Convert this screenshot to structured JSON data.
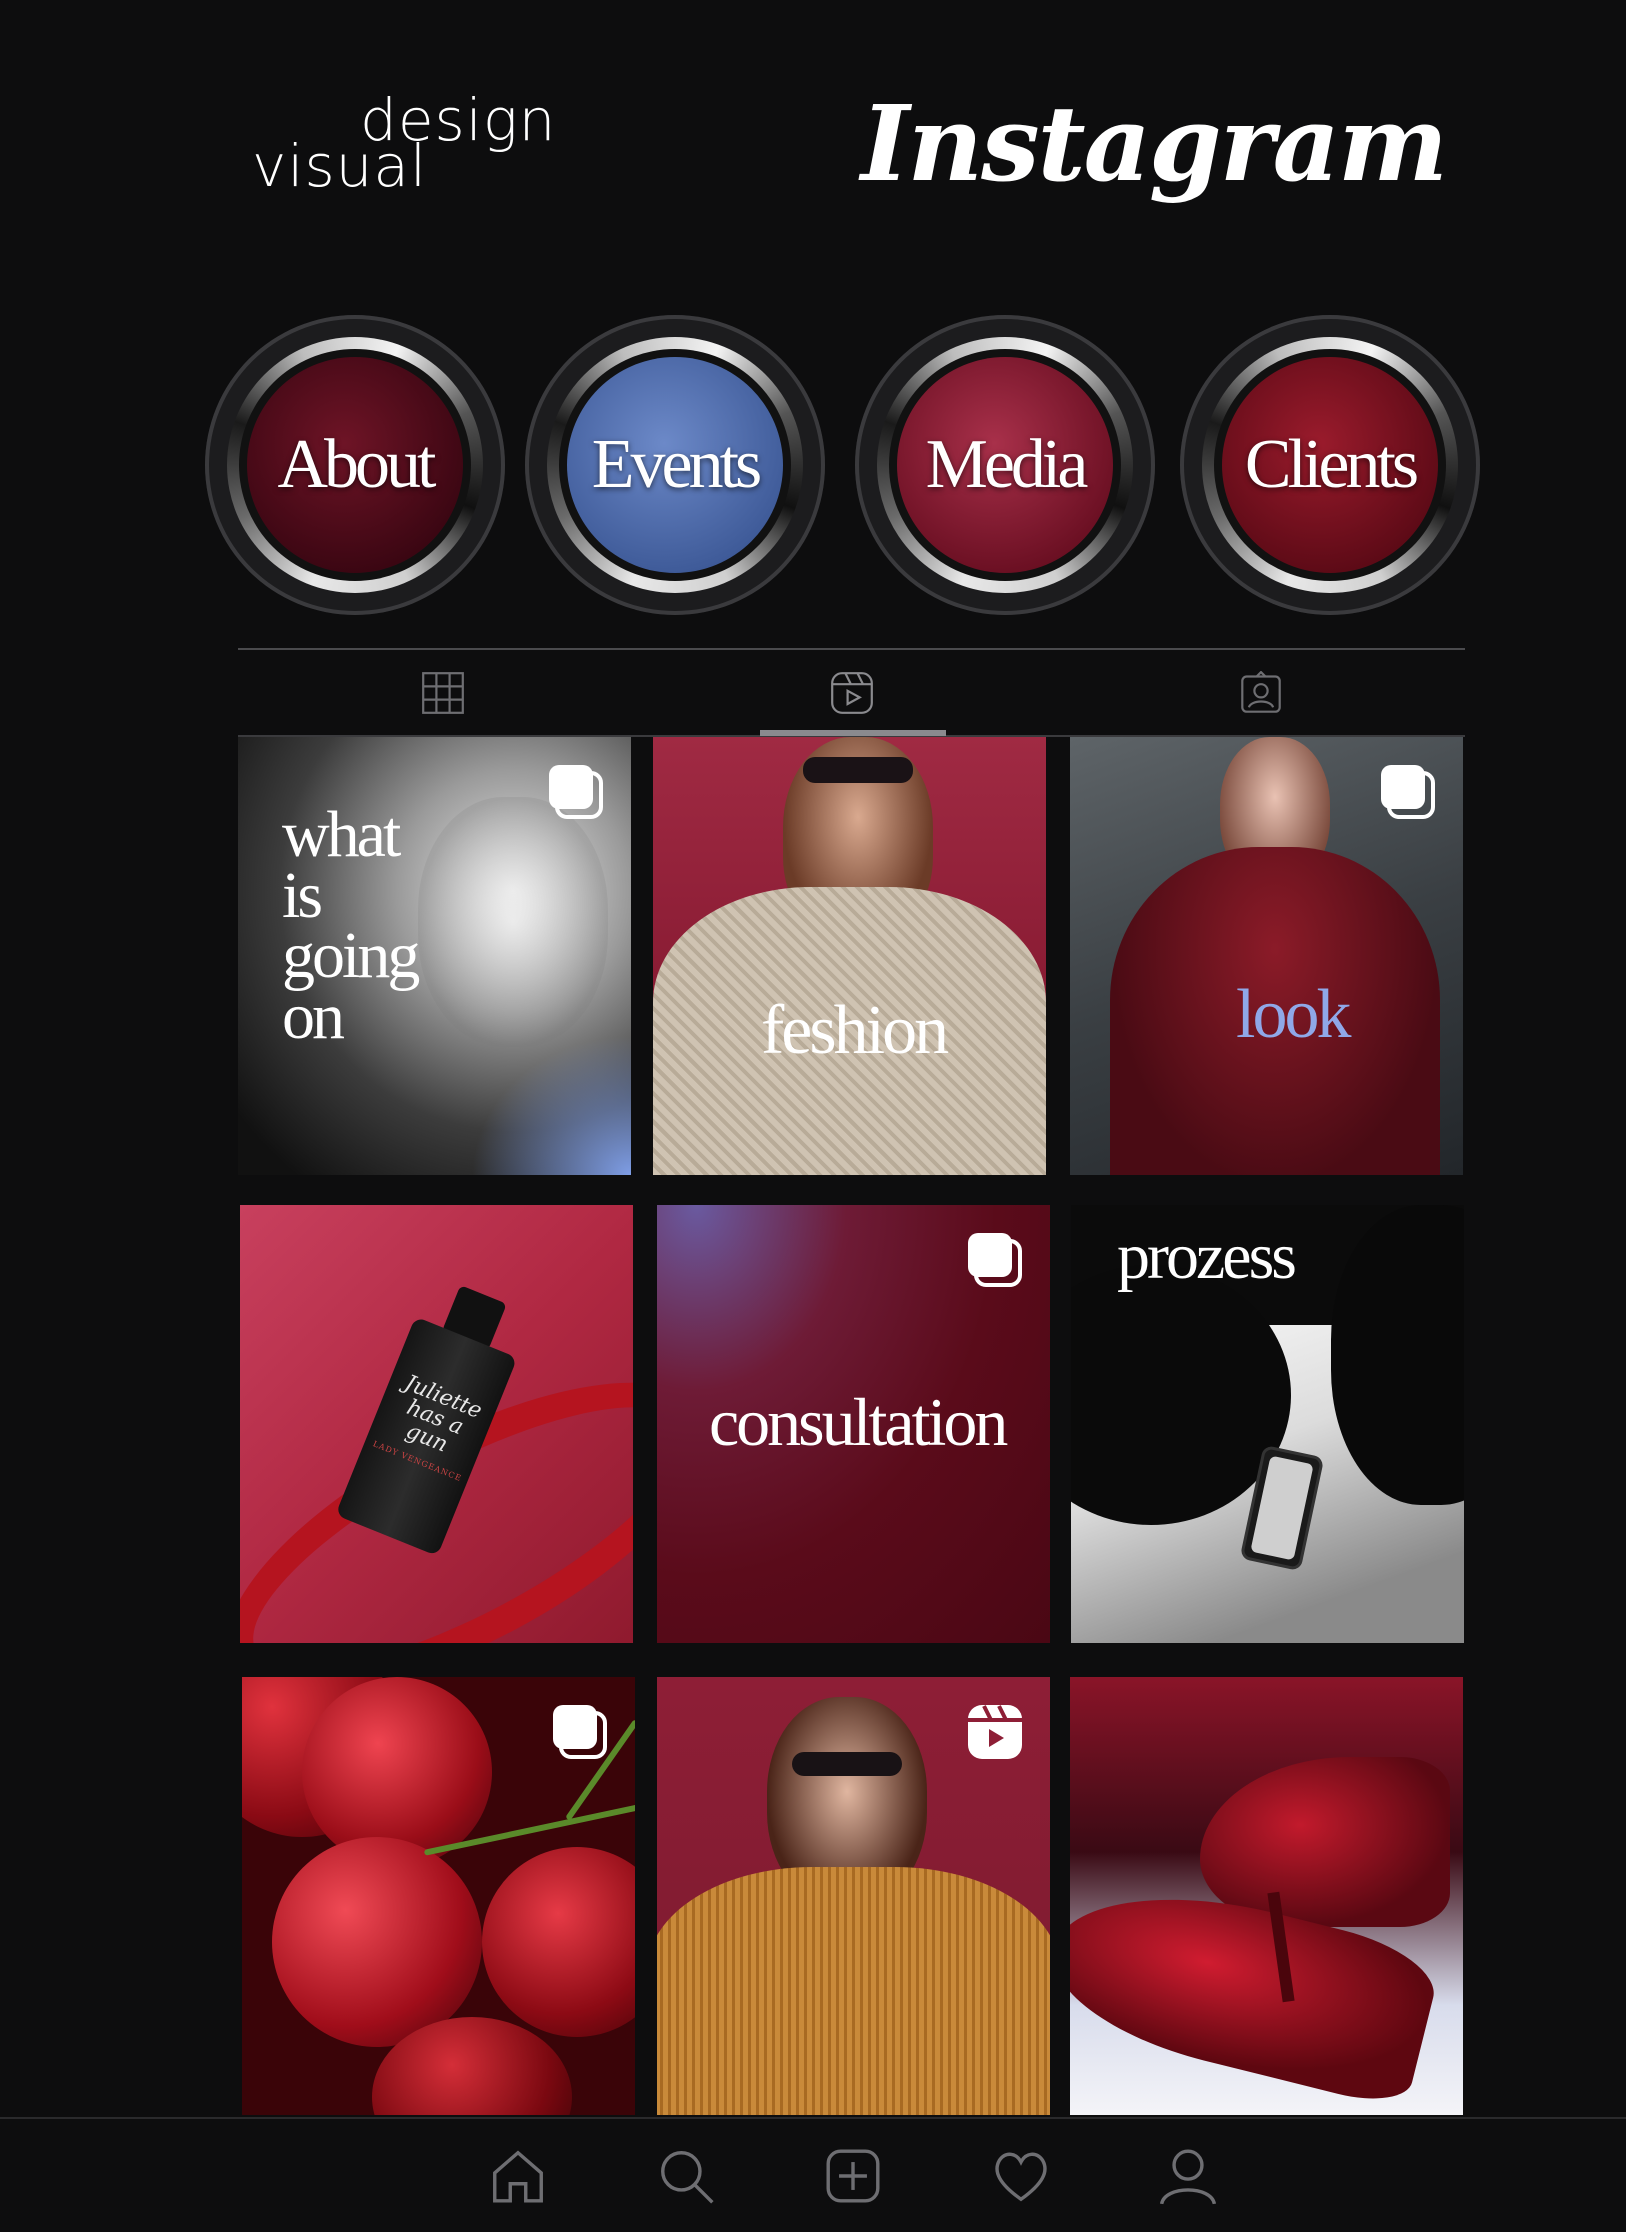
{
  "header": {
    "brand_line1": "design",
    "brand_line2": "visual",
    "app_wordmark": "Instagram"
  },
  "highlights": [
    {
      "label": "About",
      "color": "#5a0d1f"
    },
    {
      "label": "Events",
      "color": "#5b78b8"
    },
    {
      "label": "Media",
      "color": "#8e1f35"
    },
    {
      "label": "Clients",
      "color": "#7e1222"
    }
  ],
  "profile_tabs": [
    {
      "icon": "grid-icon",
      "active": false
    },
    {
      "icon": "reels-icon",
      "active": true
    },
    {
      "icon": "tagged-icon",
      "active": false
    }
  ],
  "posts": [
    {
      "caption": [
        "what",
        "is",
        "going",
        "on"
      ],
      "badge": "carousel-icon"
    },
    {
      "caption": [
        "feshion"
      ],
      "badge": ""
    },
    {
      "caption": [
        "look"
      ],
      "badge": "carousel-icon",
      "caption_color": "#8fa8e8"
    },
    {
      "caption": [],
      "bottle_text": [
        "Juliette",
        "has a gun"
      ],
      "bottle_sub": "LADY VENGEANCE",
      "badge": ""
    },
    {
      "caption": [
        "consultation"
      ],
      "badge": "carousel-icon"
    },
    {
      "caption": [
        "prozess"
      ],
      "badge": ""
    },
    {
      "caption": [],
      "badge": "carousel-icon"
    },
    {
      "caption": [],
      "badge": "reels-icon"
    },
    {
      "caption": [],
      "badge": ""
    }
  ],
  "bottom_nav": [
    {
      "icon": "home-icon"
    },
    {
      "icon": "search-icon"
    },
    {
      "icon": "add-post-icon"
    },
    {
      "icon": "heart-icon"
    },
    {
      "icon": "profile-icon"
    }
  ],
  "colors": {
    "background": "#0d0d0e",
    "accent_red": "#7a0f1f",
    "accent_blue": "#5b78b8"
  }
}
